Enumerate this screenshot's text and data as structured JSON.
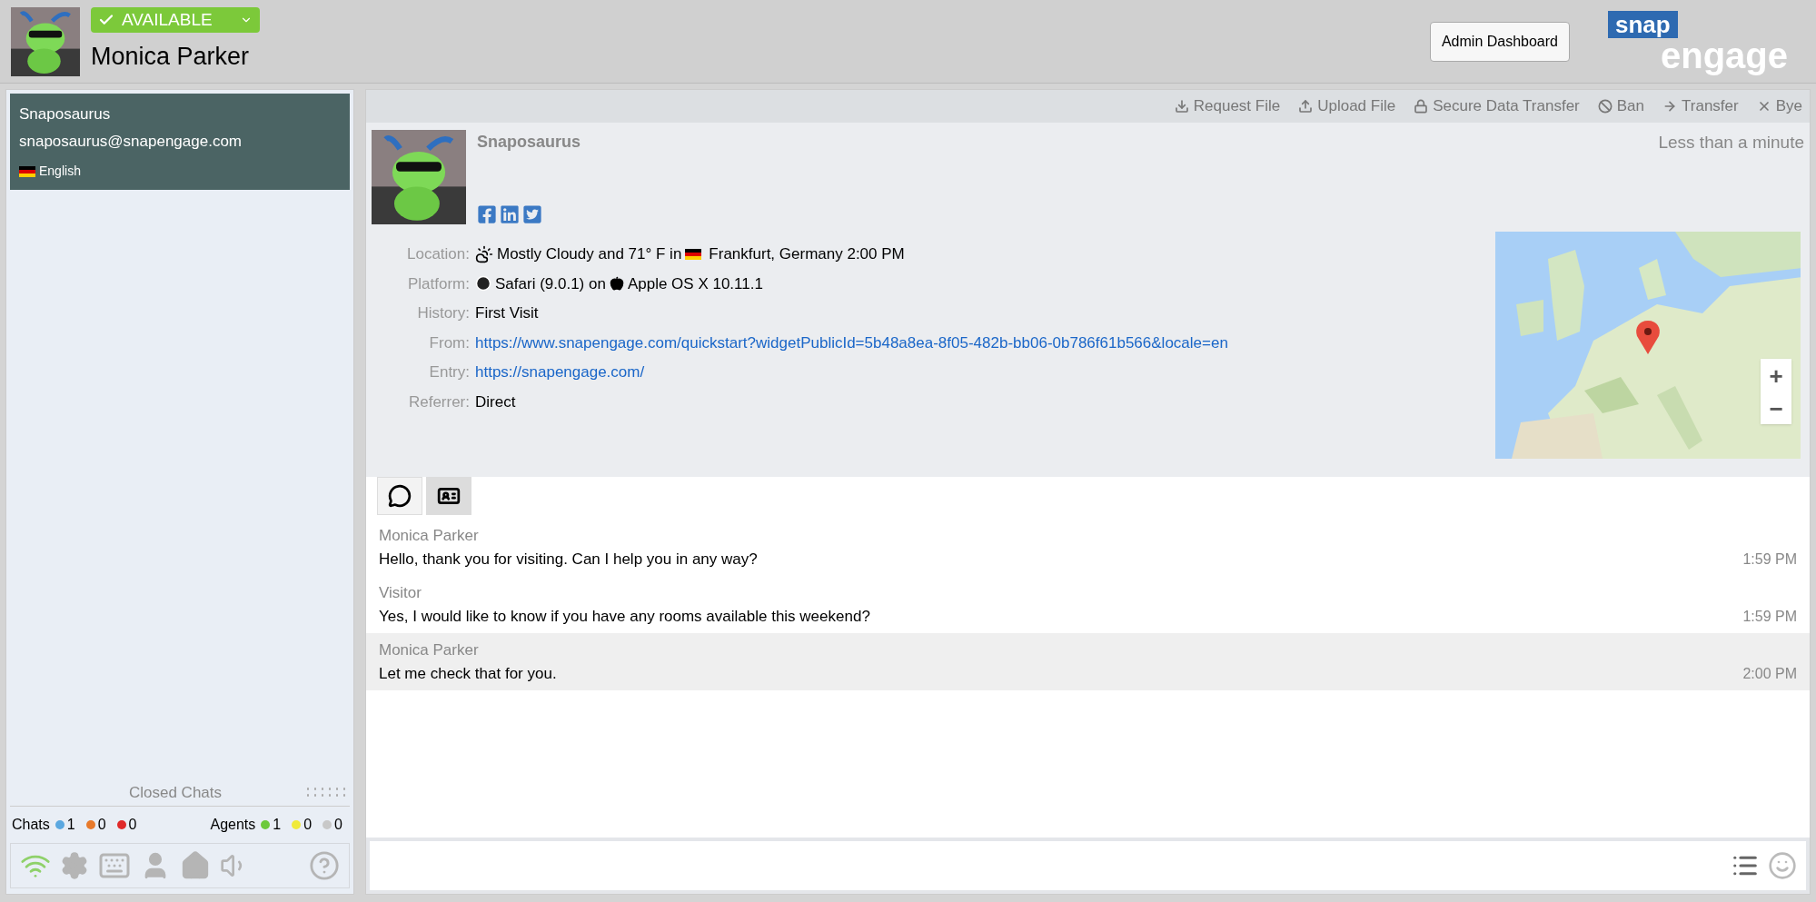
{
  "agent": {
    "status": "AVAILABLE",
    "name": "Monica Parker"
  },
  "admin_button": "Admin Dashboard",
  "logo": {
    "top": "snap",
    "bottom": "engage"
  },
  "chats": [
    {
      "name": "Snaposaurus",
      "email": "snaposaurus@snapengage.com",
      "language": "English",
      "selected": true
    }
  ],
  "closed_chats": "Closed Chats",
  "chat_counts": {
    "label": "Chats",
    "items": [
      {
        "color": "#5ba8e0",
        "count": "1"
      },
      {
        "color": "#e87a2b",
        "count": "0"
      },
      {
        "color": "#e02a2a",
        "count": "0"
      }
    ]
  },
  "agent_counts": {
    "label": "Agents",
    "items": [
      {
        "color": "#6cc93a",
        "count": "1"
      },
      {
        "color": "#f0ea3a",
        "count": "0"
      },
      {
        "color": "#c8c8c8",
        "count": "0"
      }
    ]
  },
  "toolbar": [
    {
      "kind": "download",
      "label": "Request File"
    },
    {
      "kind": "upload",
      "label": "Upload File"
    },
    {
      "kind": "lock",
      "label": "Secure Data Transfer"
    },
    {
      "kind": "ban",
      "label": "Ban"
    },
    {
      "kind": "transfer",
      "label": "Transfer"
    },
    {
      "kind": "close",
      "label": "Bye"
    }
  ],
  "visitor": {
    "name": "Snaposaurus",
    "duration": "Less than a minute",
    "details": [
      {
        "label": "Location:",
        "kind": "location",
        "value": "Mostly Cloudy and 71° F in",
        "value2": "Frankfurt, Germany 2:00 PM"
      },
      {
        "label": "Platform:",
        "kind": "platform",
        "value": "Safari (9.0.1) on",
        "value2": "Apple OS X 10.11.1"
      },
      {
        "label": "History:",
        "kind": "text",
        "value": "First Visit"
      },
      {
        "label": "From:",
        "kind": "link",
        "value": "https://www.snapengage.com/quickstart?widgetPublicId=5b48a8ea-8f05-482b-bb06-0b786f61b566&locale=en"
      },
      {
        "label": "Entry:",
        "kind": "link",
        "value": "https://snapengage.com/"
      },
      {
        "label": "Referrer:",
        "kind": "text",
        "value": "Direct"
      }
    ]
  },
  "map_controls": [
    "+",
    "−"
  ],
  "tabs": [
    {
      "kind": "chat",
      "selected": true
    },
    {
      "kind": "card",
      "selected": false
    }
  ],
  "messages": [
    {
      "sender": "Monica Parker",
      "text": "Hello, thank you for visiting. Can I help you in any way?",
      "time": "1:59 PM",
      "highlighted": false
    },
    {
      "sender": "Visitor",
      "text": "Yes, I would like to know if you have any rooms available this weekend?",
      "time": "1:59 PM",
      "highlighted": false
    },
    {
      "sender": "Monica Parker",
      "text": "Let me check that for you.",
      "time": "2:00 PM",
      "highlighted": true
    }
  ]
}
